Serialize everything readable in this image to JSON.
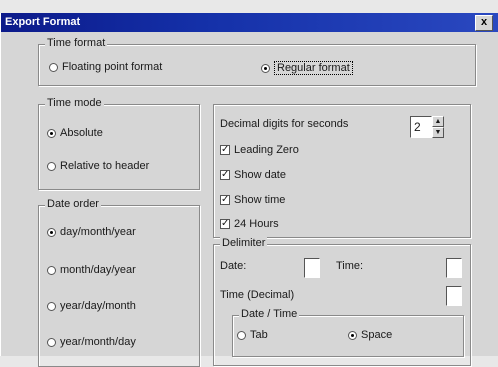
{
  "window": {
    "title": "Export Format",
    "close_glyph": "x"
  },
  "time_format": {
    "legend": "Time format",
    "options": [
      {
        "label": "Floating point format",
        "selected": false
      },
      {
        "label": "Regular format",
        "selected": true
      }
    ]
  },
  "time_mode": {
    "legend": "Time mode",
    "options": [
      {
        "label": "Absolute",
        "selected": true
      },
      {
        "label": "Relative to header",
        "selected": false
      }
    ]
  },
  "date_order": {
    "legend": "Date order",
    "options": [
      {
        "label": "day/month/year",
        "selected": true
      },
      {
        "label": "month/day/year",
        "selected": false
      },
      {
        "label": "year/day/month",
        "selected": false
      },
      {
        "label": "year/month/day",
        "selected": false
      }
    ]
  },
  "display": {
    "decimal_label": "Decimal digits for seconds",
    "decimal_value": "2",
    "checks": [
      {
        "label": "Leading Zero",
        "checked": true
      },
      {
        "label": "Show date",
        "checked": true
      },
      {
        "label": "Show time",
        "checked": true
      },
      {
        "label": "24 Hours",
        "checked": true
      }
    ]
  },
  "delimiter": {
    "legend": "Delimiter",
    "date_label": "Date:",
    "date_value": "",
    "time_label": "Time:",
    "time_value": "",
    "time_decimal_label": "Time (Decimal)",
    "time_decimal_value": "",
    "date_time": {
      "legend": "Date / Time",
      "options": [
        {
          "label": "Tab",
          "selected": false
        },
        {
          "label": "Space",
          "selected": true
        }
      ]
    }
  }
}
